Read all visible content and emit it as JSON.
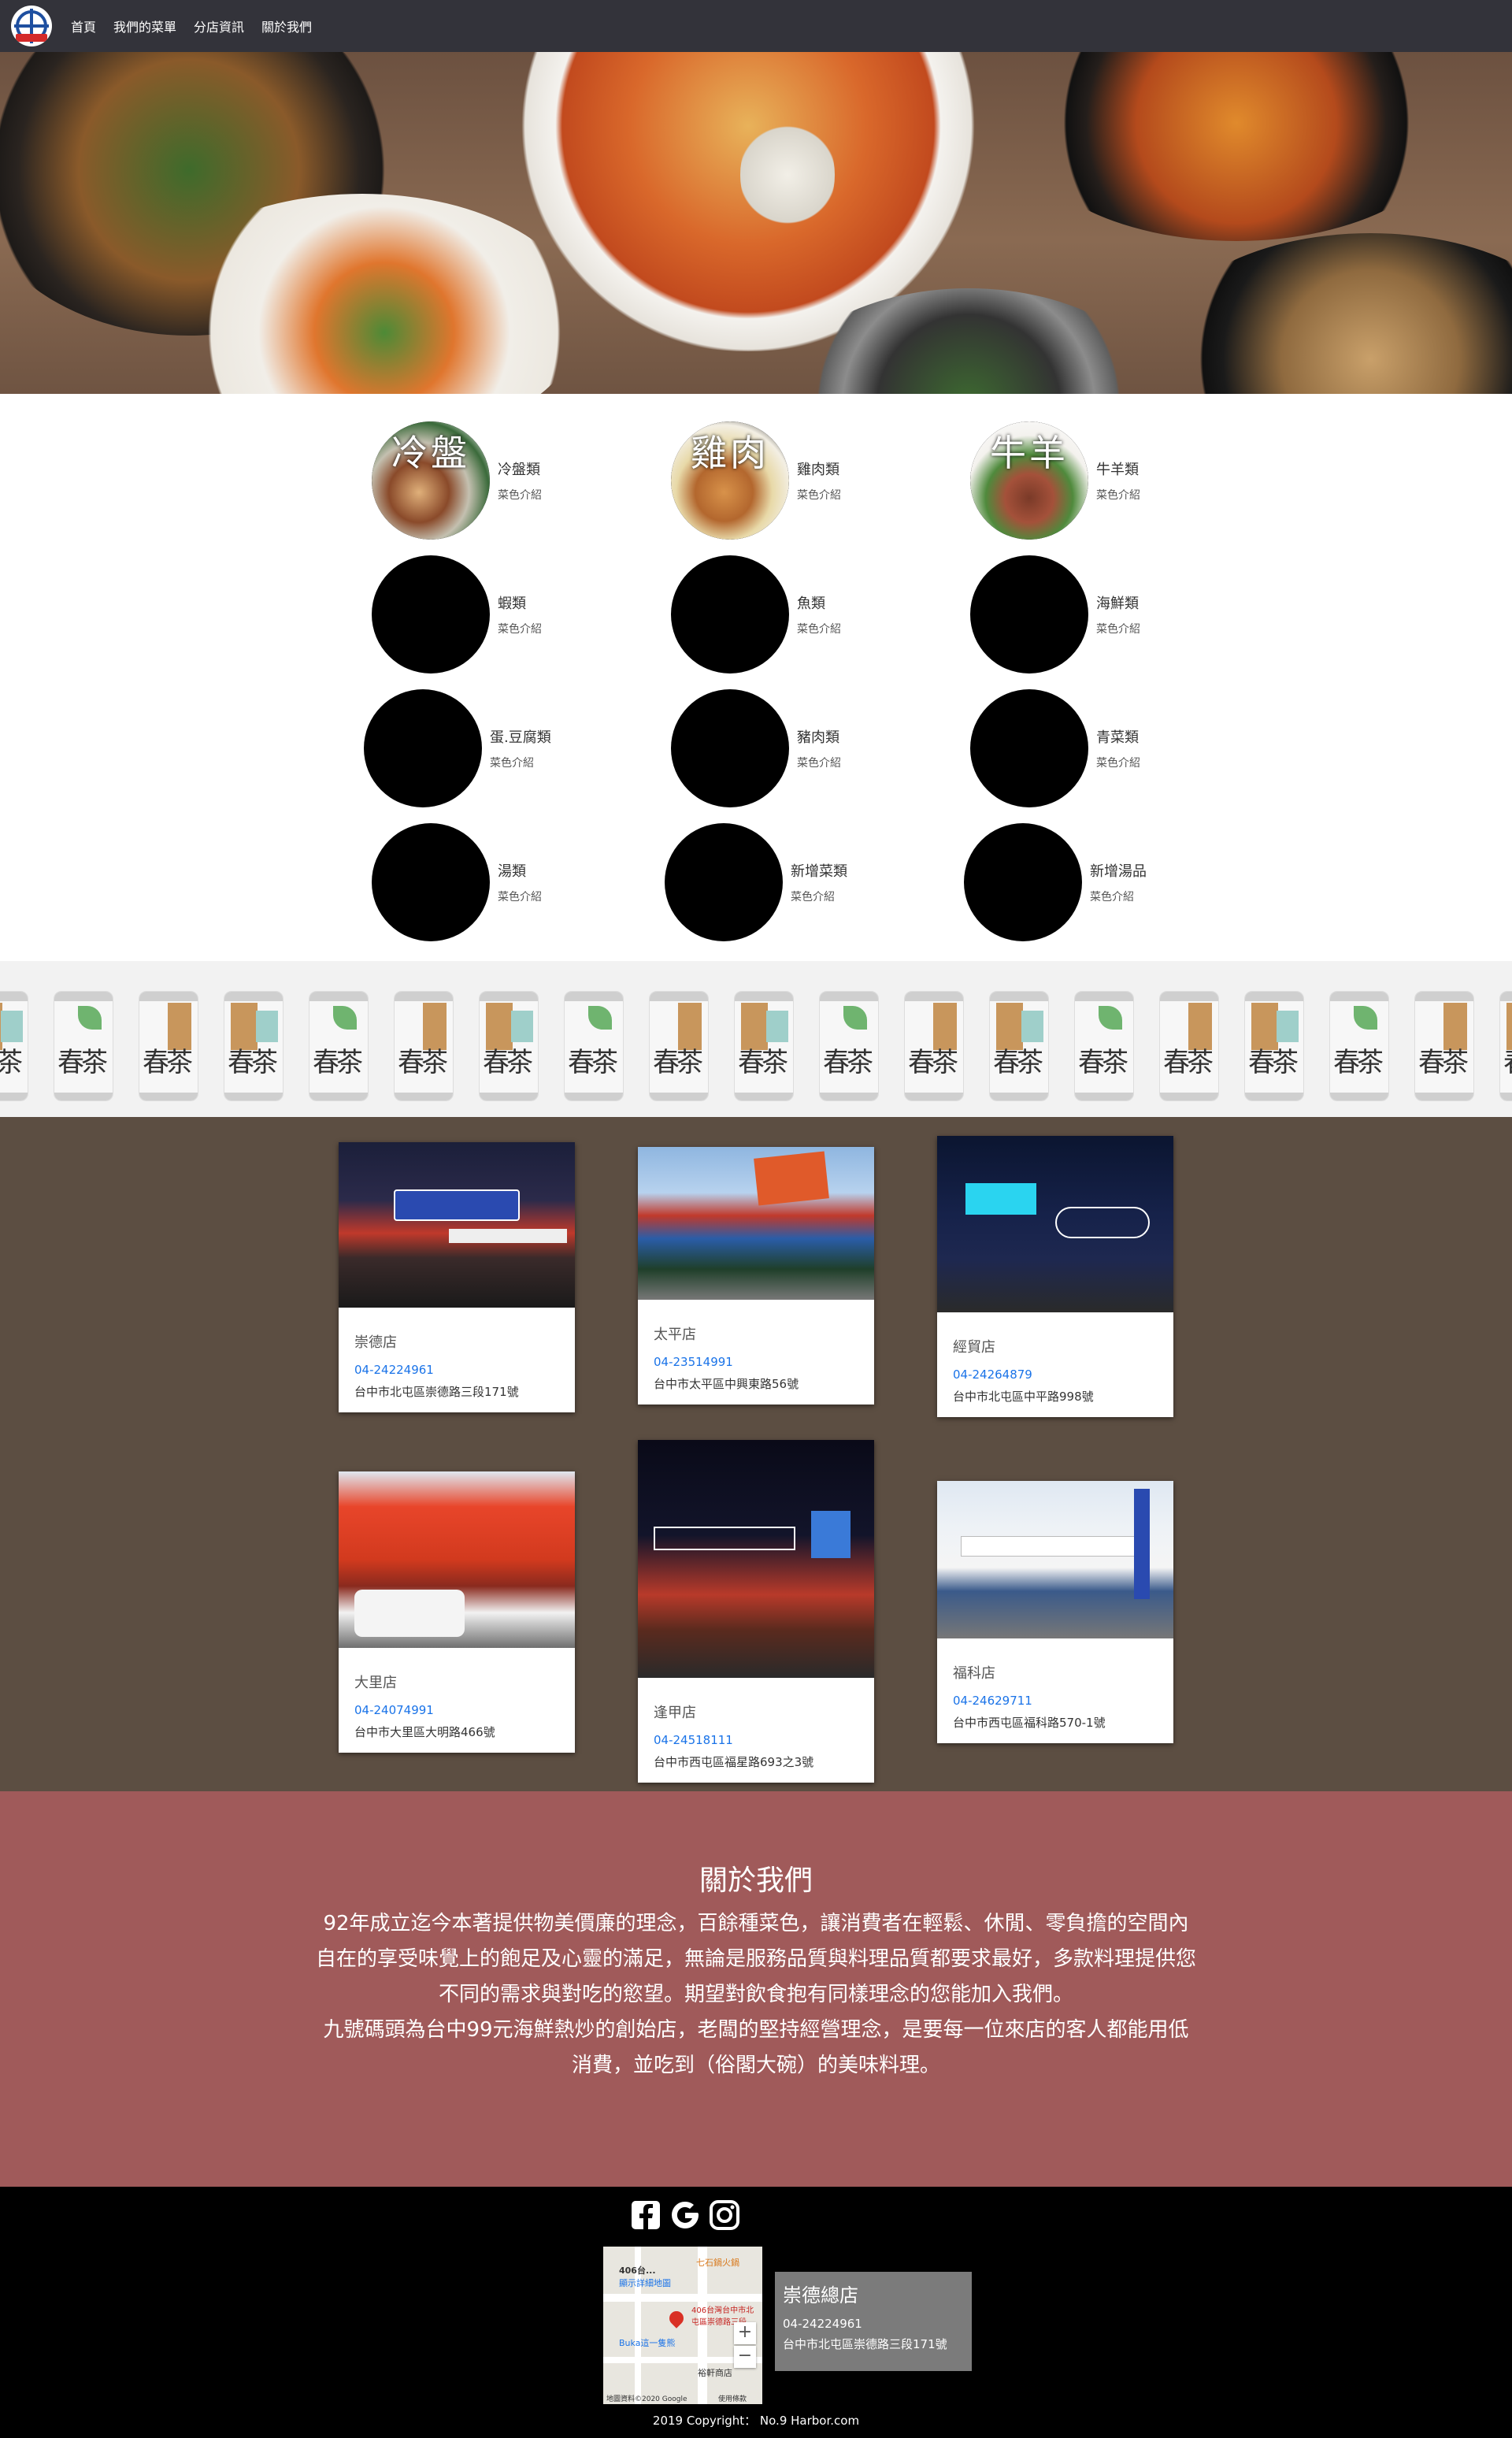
{
  "nav": {
    "links": [
      "首頁",
      "我們的菜單",
      "分店資訊",
      "關於我們"
    ]
  },
  "menu": {
    "items": [
      {
        "title": "冷盤類",
        "sub": "菜色介紹",
        "char": "冷盤",
        "has_photo": true
      },
      {
        "title": "雞肉類",
        "sub": "菜色介紹",
        "char": "雞肉",
        "has_photo": true
      },
      {
        "title": "牛羊類",
        "sub": "菜色介紹",
        "char": "牛羊",
        "has_photo": true
      },
      {
        "title": "蝦類",
        "sub": "菜色介紹"
      },
      {
        "title": "魚類",
        "sub": "菜色介紹"
      },
      {
        "title": "海鮮類",
        "sub": "菜色介紹"
      },
      {
        "title": "蛋.豆腐類",
        "sub": "菜色介紹"
      },
      {
        "title": "豬肉類",
        "sub": "菜色介紹"
      },
      {
        "title": "青菜類",
        "sub": "菜色介紹"
      },
      {
        "title": "湯類",
        "sub": "菜色介紹"
      },
      {
        "title": "新增菜類",
        "sub": "菜色介紹"
      },
      {
        "title": "新增湯品",
        "sub": "菜色介紹"
      }
    ]
  },
  "cans": {
    "text": "春茶"
  },
  "stores": [
    {
      "name": "崇德店",
      "phone": "04-24224961",
      "address": "台中市北屯區崇德路三段171號"
    },
    {
      "name": "太平店",
      "phone": "04-23514991",
      "address": "台中市太平區中興東路56號"
    },
    {
      "name": "經貿店",
      "phone": "04-24264879",
      "address": "台中市北屯區中平路998號"
    },
    {
      "name": "大里店",
      "phone": "04-24074991",
      "address": "台中市大里區大明路466號"
    },
    {
      "name": "逢甲店",
      "phone": "04-24518111",
      "address": "台中市西屯區福星路693之3號"
    },
    {
      "name": "福科店",
      "phone": "04-24629711",
      "address": "台中市西屯區福科路570-1號"
    }
  ],
  "about": {
    "title": "關於我們",
    "para1": "92年成立迄今本著提供物美價廉的理念，百餘種菜色，讓消費者在輕鬆、休閒、零負擔的空間內自在的享受味覺上的飽足及心靈的滿足，無論是服務品質與料理品質都要求最好，多款料理提供您不同的需求與對吃的慾望。期望對飲食抱有同樣理念的您能加入我們。",
    "para2": "九號碼頭為台中99元海鮮熱炒的創始店，老闆的堅持經營理念，是要每一位來店的客人都能用低消費，並吃到（俗閣大碗）的美味料理。"
  },
  "footer": {
    "socials": [
      "facebook-icon",
      "google-icon",
      "instagram-icon"
    ],
    "map": {
      "labels": [
        "406台...",
        "顯示詳細地圖",
        "七石鍋火鍋",
        "406台灣台中市北屯區崇德路三段",
        "Buka這一隻熊",
        "裕軒商店",
        "地圖資料©2020 Google",
        "使用條款"
      ],
      "zoom_in": "+",
      "zoom_out": "−"
    },
    "hq": {
      "name": "崇德總店",
      "phone": "04-24224961",
      "address": "台中市北屯區崇德路三段171號"
    },
    "copyright": "2019 Copyright： No.9 Harbor.com"
  },
  "colors": {
    "nav_bg": "#33333a",
    "stores_bg": "#5c4e42",
    "about_bg": "#a05a5a",
    "footer_bg": "#000000",
    "link": "#1a73e8"
  }
}
